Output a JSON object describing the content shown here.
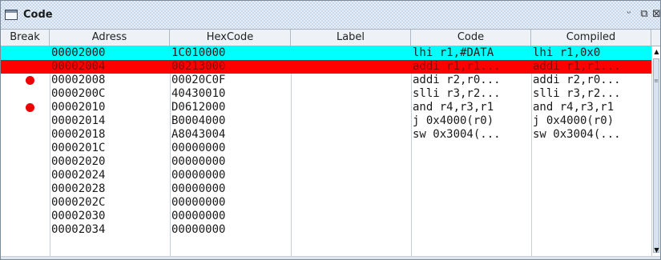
{
  "window": {
    "title": "Code",
    "icon": "window-icon",
    "buttons": {
      "minimize": "ᵕ",
      "maximize": "⧉",
      "close": "⊠"
    }
  },
  "table": {
    "columns": [
      "Break",
      "Adress",
      "HexCode",
      "Label",
      "Code",
      "Compiled"
    ],
    "rows": [
      {
        "breakpoint": false,
        "address": "00002000",
        "hex": "1C010000",
        "label": "",
        "code": "lhi r1,#DATA",
        "compiled": "lhi r1,0x0",
        "highlight": "cyan"
      },
      {
        "breakpoint": false,
        "address": "00002004",
        "hex": "00213000",
        "label": "",
        "code": "addi r1,r1...",
        "compiled": "addi r1,r1...",
        "highlight": "red"
      },
      {
        "breakpoint": true,
        "address": "00002008",
        "hex": "00020C0F",
        "label": "",
        "code": "addi r2,r0...",
        "compiled": "addi r2,r0...",
        "highlight": ""
      },
      {
        "breakpoint": false,
        "address": "0000200C",
        "hex": "40430010",
        "label": "",
        "code": "slli r3,r2...",
        "compiled": "slli r3,r2...",
        "highlight": ""
      },
      {
        "breakpoint": true,
        "address": "00002010",
        "hex": "D0612000",
        "label": "",
        "code": "and r4,r3,r1",
        "compiled": "and r4,r3,r1",
        "highlight": ""
      },
      {
        "breakpoint": false,
        "address": "00002014",
        "hex": "B0004000",
        "label": "",
        "code": "j 0x4000(r0)",
        "compiled": "j 0x4000(r0)",
        "highlight": ""
      },
      {
        "breakpoint": false,
        "address": "00002018",
        "hex": "A8043004",
        "label": "",
        "code": "sw 0x3004(...",
        "compiled": "sw 0x3004(...",
        "highlight": ""
      },
      {
        "breakpoint": false,
        "address": "0000201C",
        "hex": "00000000",
        "label": "",
        "code": "",
        "compiled": "",
        "highlight": ""
      },
      {
        "breakpoint": false,
        "address": "00002020",
        "hex": "00000000",
        "label": "",
        "code": "",
        "compiled": "",
        "highlight": ""
      },
      {
        "breakpoint": false,
        "address": "00002024",
        "hex": "00000000",
        "label": "",
        "code": "",
        "compiled": "",
        "highlight": ""
      },
      {
        "breakpoint": false,
        "address": "00002028",
        "hex": "00000000",
        "label": "",
        "code": "",
        "compiled": "",
        "highlight": ""
      },
      {
        "breakpoint": false,
        "address": "0000202C",
        "hex": "00000000",
        "label": "",
        "code": "",
        "compiled": "",
        "highlight": ""
      },
      {
        "breakpoint": false,
        "address": "00002030",
        "hex": "00000000",
        "label": "",
        "code": "",
        "compiled": "",
        "highlight": ""
      },
      {
        "breakpoint": false,
        "address": "00002034",
        "hex": "00000000",
        "label": "",
        "code": "",
        "compiled": "",
        "highlight": ""
      }
    ]
  },
  "colors": {
    "highlight_cyan": "#00ffff",
    "highlight_red": "#ff0000",
    "breakpoint": "#ee0000",
    "titlebar": "#c9d9ec"
  },
  "scrollbar": {
    "up_icon": "scroll-up-icon",
    "down_icon": "scroll-down-icon",
    "up": "▲",
    "down": "▼",
    "grip": "≡"
  }
}
